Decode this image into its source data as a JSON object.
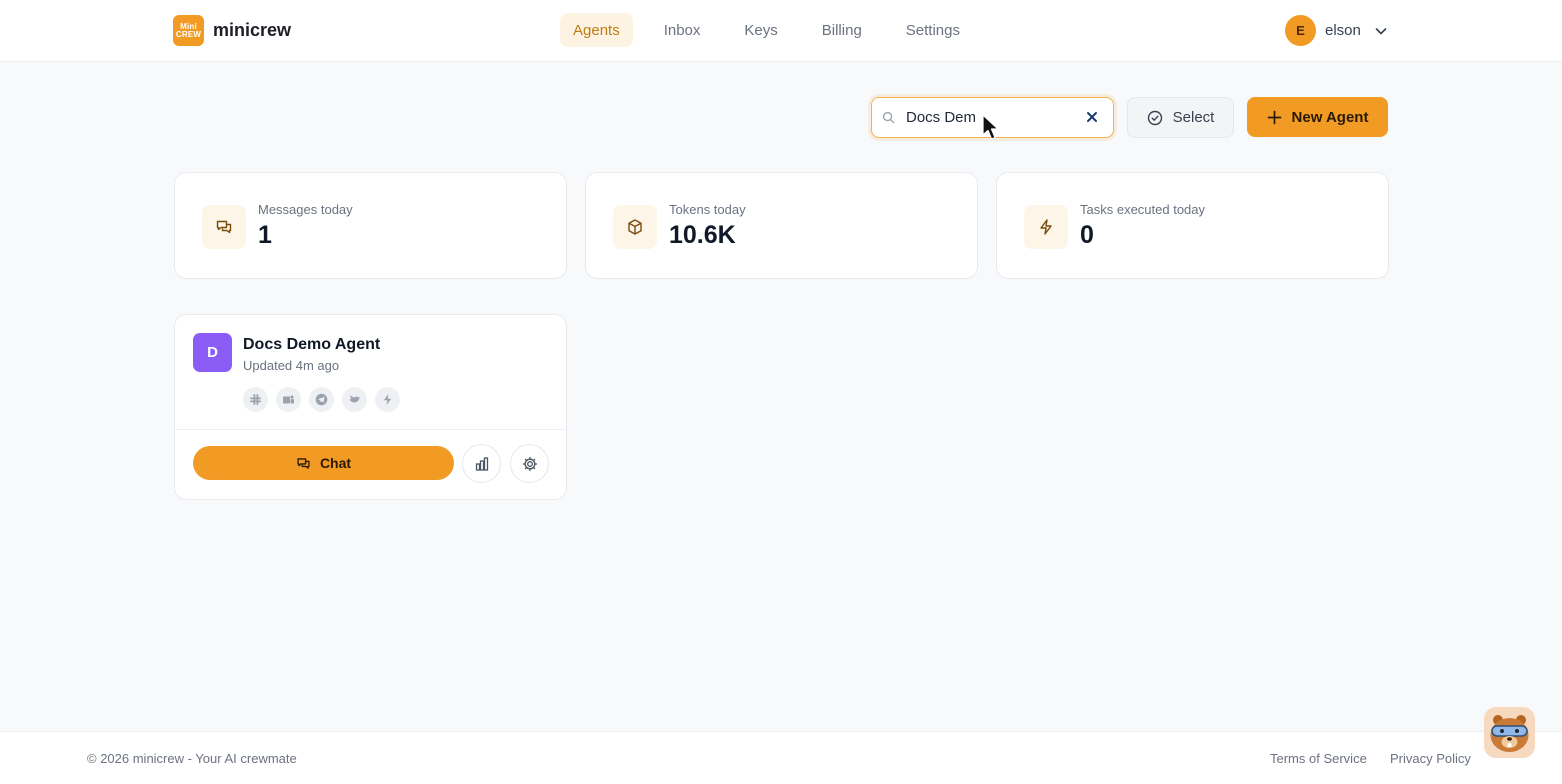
{
  "app": {
    "logo_mark_top": "Mini",
    "logo_mark_bottom": "CREW",
    "name": "minicrew"
  },
  "nav": {
    "items": [
      {
        "label": "Agents",
        "active": true
      },
      {
        "label": "Inbox",
        "active": false
      },
      {
        "label": "Keys",
        "active": false
      },
      {
        "label": "Billing",
        "active": false
      },
      {
        "label": "Settings",
        "active": false
      }
    ]
  },
  "user": {
    "initial": "E",
    "name": "elson"
  },
  "toolbar": {
    "search_value": "Docs Dem",
    "select_label": "Select",
    "new_agent_label": "New Agent"
  },
  "stats": [
    {
      "label": "Messages today",
      "value": "1",
      "icon": "chat-bubbles-icon"
    },
    {
      "label": "Tokens today",
      "value": "10.6K",
      "icon": "cube-icon"
    },
    {
      "label": "Tasks executed today",
      "value": "0",
      "icon": "lightning-icon"
    }
  ],
  "agent": {
    "initial": "D",
    "name": "Docs Demo Agent",
    "updated": "Updated 4m ago",
    "channels": [
      "slack-icon",
      "teams-icon",
      "telegram-icon",
      "bird-icon",
      "lightning-icon"
    ],
    "chat_label": "Chat"
  },
  "footer": {
    "copyright": "© 2026 minicrew - Your AI crewmate",
    "terms": "Terms of Service",
    "privacy": "Privacy Policy"
  },
  "colors": {
    "accent": "#f29b24",
    "accent_soft": "#fdf3e3",
    "agent_avatar": "#8b5cf6",
    "background": "#f8f9fb"
  }
}
